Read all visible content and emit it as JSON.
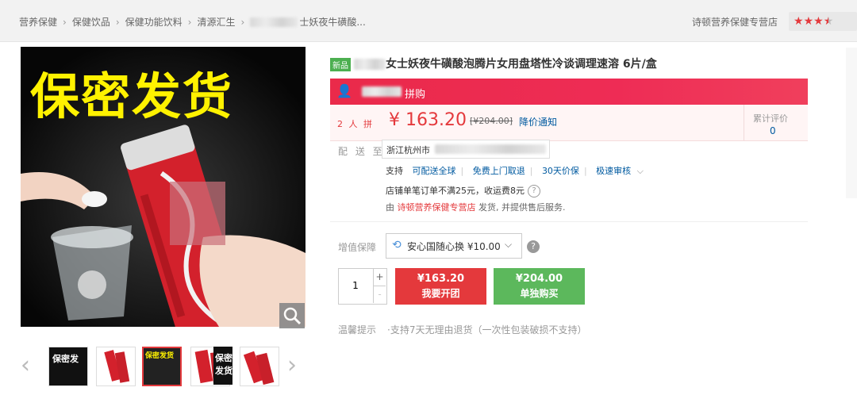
{
  "breadcrumbs": [
    "营养保健",
    "保健饮品",
    "保健功能饮料",
    "清源汇生",
    "士妖夜牛磺酸..."
  ],
  "store": {
    "name": "诗顿营养保健专营店",
    "rating_stars": 3.5
  },
  "product": {
    "image_overlay_text": "保密发货",
    "new_tag": "新品",
    "title": "女士妖夜牛磺酸泡腾片女用盘塔性冷谈调理速溶 6片/盒",
    "banner_text": "拼购",
    "group_label": "2 人 拼",
    "price": "¥ 163.20",
    "original_price": "[¥204.00]",
    "price_notify": "降价通知",
    "reviews": {
      "label": "累计评价",
      "value": "0"
    }
  },
  "delivery": {
    "label": "配 送 至",
    "address": "浙江杭州市",
    "support_label": "支持",
    "support_items": [
      "可配送全球",
      "免费上门取退",
      "30天价保",
      "极速审核"
    ],
    "shipping_fee": "店铺单笔订单不满25元，收运费8元",
    "provided_prefix": "由",
    "provided_store": "诗顿营养保健专营店",
    "provided_suffix": "发货, 并提供售后服务."
  },
  "protection": {
    "label": "增值保障",
    "selected": "安心国随心换 ¥10.00"
  },
  "quantity": {
    "value": "1",
    "plus": "+",
    "minus": "-"
  },
  "buttons": {
    "group_buy": {
      "price": "¥163.20",
      "label": "我要开团"
    },
    "solo_buy": {
      "price": "¥204.00",
      "label": "单独购买"
    }
  },
  "tips": {
    "label": "温馨提示",
    "text": "·支持7天无理由退货（一次性包装破损不支持）"
  },
  "thumbnails": [
    {
      "text": "保密发"
    },
    {
      "text": ""
    },
    {
      "text": "保密发货",
      "selected": true
    },
    {
      "text": ""
    },
    {
      "text": "保密发货"
    },
    {
      "text": ""
    }
  ],
  "colors": {
    "accent_red": "#e4393c",
    "green": "#5cb85c",
    "link_blue": "#005aa0"
  }
}
